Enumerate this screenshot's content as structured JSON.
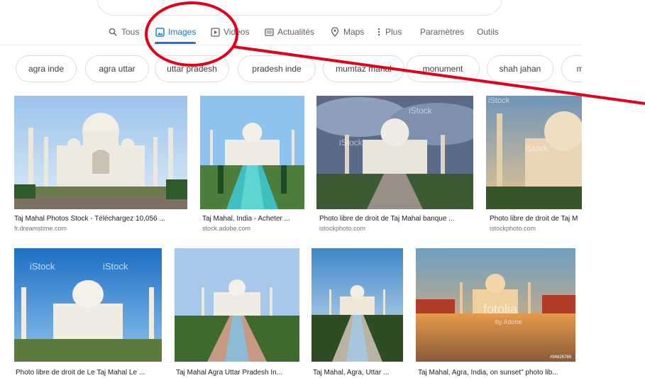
{
  "tabs": [
    {
      "label": "Tous",
      "icon": "search-icon"
    },
    {
      "label": "Images",
      "icon": "image-icon",
      "active": true
    },
    {
      "label": "Vidéos",
      "icon": "play-icon"
    },
    {
      "label": "Actualités",
      "icon": "news-icon"
    },
    {
      "label": "Maps",
      "icon": "map-pin-icon"
    },
    {
      "label": "Plus",
      "icon": "more-vert-icon"
    },
    {
      "label": "Paramètres"
    },
    {
      "label": "Outils"
    }
  ],
  "chips": [
    "agra inde",
    "agra uttar",
    "uttar pradesh",
    "pradesh inde",
    "mumtaz mahal",
    "monument",
    "shah jahan",
    "ma"
  ],
  "results": [
    {
      "title": "Taj Mahal Photos Stock - Téléchargez 10,056 ...",
      "source": "fr.dreamstime.com"
    },
    {
      "title": "Taj Mahal, India - Acheter ...",
      "source": "stock.adobe.com"
    },
    {
      "title": "Photo libre de droit de Taj Mahal banque ...",
      "source": "istockphoto.com",
      "watermark": "iStock"
    },
    {
      "title": "Photo libre de droit de Taj M",
      "source": "istockphoto.com",
      "watermark": "iStock"
    },
    {
      "title": "Photo libre de droit de Le Taj Mahal Le ...",
      "source": "",
      "watermark": "iStock"
    },
    {
      "title": "Taj Mahal Agra Uttar Pradesh In...",
      "source": ""
    },
    {
      "title": "Taj Mahal, Agra, Uttar ...",
      "source": ""
    },
    {
      "title": "Taj Mahal, Agra, India, on sunset\" photo lib...",
      "source": "",
      "watermark": "fotolia",
      "watermark_sub": "by Adobe",
      "stock_id": "#94826786"
    }
  ],
  "colors": {
    "accent": "#1a73e8",
    "annotation": "#e4001b"
  }
}
